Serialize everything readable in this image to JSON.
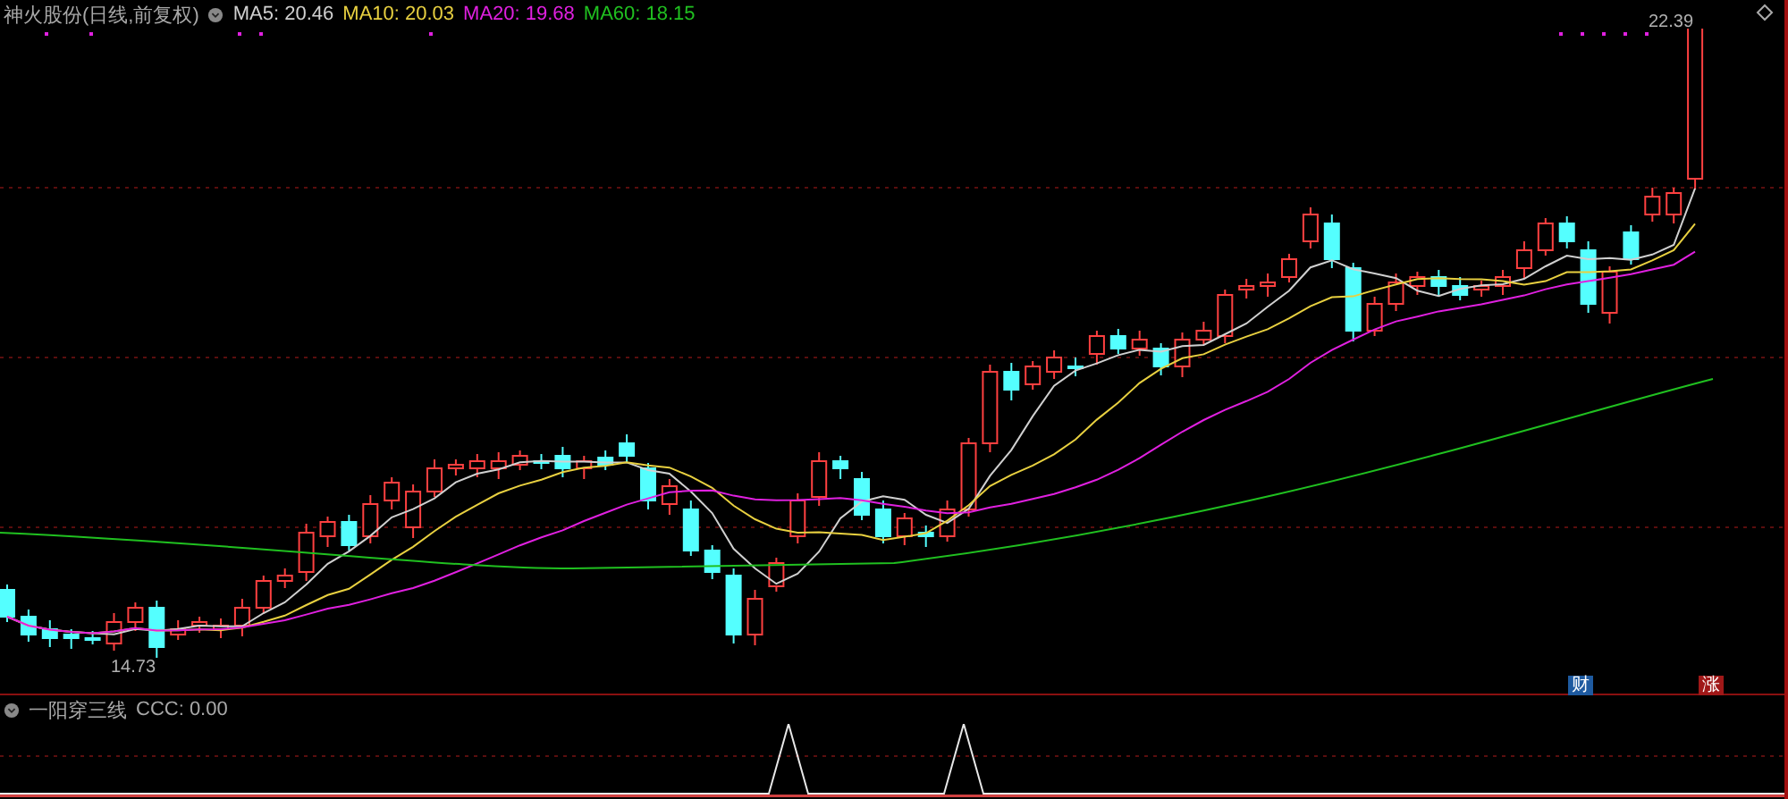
{
  "header": {
    "title": "神火股份(日线,前复权)",
    "moving_averages": [
      {
        "label": "MA5: 20.46",
        "color": "#d0d0d0"
      },
      {
        "label": "MA10: 20.03",
        "color": "#e8d040"
      },
      {
        "label": "MA20: 19.68",
        "color": "#e020e0"
      },
      {
        "label": "MA60: 18.15",
        "color": "#20c020"
      }
    ]
  },
  "price_labels": {
    "high": "22.39",
    "low": "14.73"
  },
  "badges": [
    {
      "text": "财",
      "color": "#1e5aa0"
    },
    {
      "text": "涨",
      "color": "#a01818"
    }
  ],
  "indicator": {
    "name": "一阳穿三线",
    "reading": "CCC: 0.00"
  }
}
